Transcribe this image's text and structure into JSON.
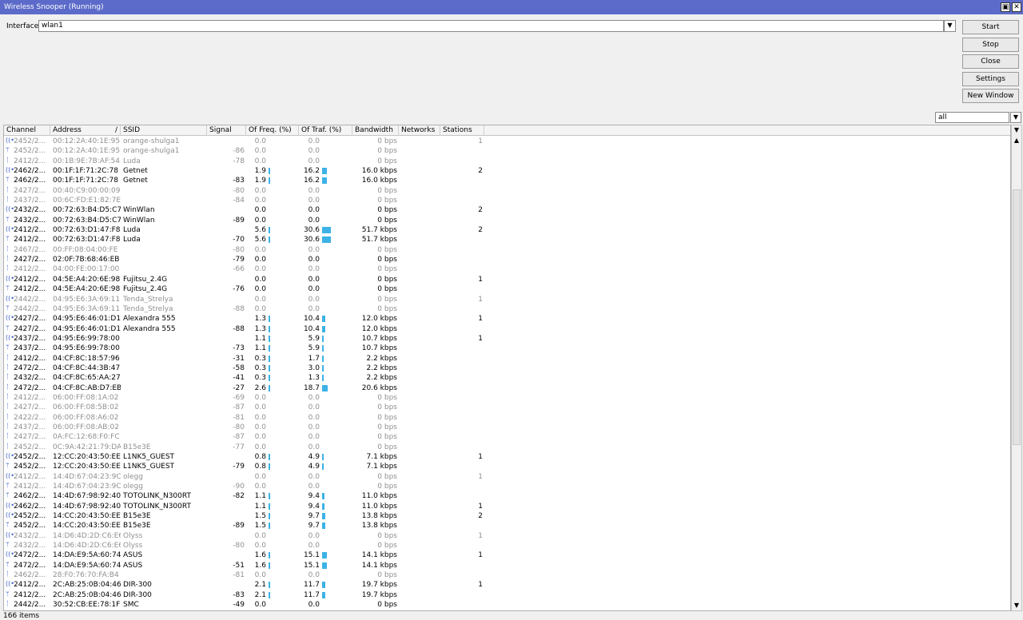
{
  "window": {
    "title": "Wireless Snooper (Running)",
    "restore_glyph": "▣",
    "close_glyph": "✕"
  },
  "interface": {
    "label": "Interface:",
    "value": "wlan1"
  },
  "buttons": {
    "start": "Start",
    "stop": "Stop",
    "close": "Close",
    "settings": "Settings",
    "new_window": "New Window"
  },
  "filter": {
    "value": "all"
  },
  "columns": [
    "Channel",
    "Address",
    "SSID",
    "Signal",
    "Of Freq. (%)",
    "Of Traf. (%)",
    "Bandwidth",
    "Networks",
    "Stations"
  ],
  "sort_indicator": "/",
  "rows": [
    {
      "t": "n",
      "ch": "2452/2...",
      "addr": "00:12:2A:40:1E:95",
      "ssid": "orange-shulga1",
      "sig": "",
      "freq": "0.0",
      "traf": "0.0",
      "bw": "0 bps",
      "net": "",
      "sta": "1",
      "dim": true,
      "fv": 0,
      "tv": 0
    },
    {
      "t": "s",
      "ch": "2452/2...",
      "addr": "00:12:2A:40:1E:95",
      "ssid": "orange-shulga1",
      "sig": "-86",
      "freq": "0.0",
      "traf": "0.0",
      "bw": "0 bps",
      "net": "",
      "sta": "",
      "dim": true,
      "fv": 0,
      "tv": 0
    },
    {
      "t": "c",
      "ch": "2412/2...",
      "addr": "00:1B:9E:7B:AF:54",
      "ssid": "Luda",
      "sig": "-78",
      "freq": "0.0",
      "traf": "0.0",
      "bw": "0 bps",
      "net": "",
      "sta": "",
      "dim": true,
      "fv": 0,
      "tv": 0
    },
    {
      "t": "n",
      "ch": "2462/2...",
      "addr": "00:1F:1F:71:2C:78",
      "ssid": "Getnet",
      "sig": "",
      "freq": "1.9",
      "traf": "16.2",
      "bw": "16.0 kbps",
      "net": "",
      "sta": "2",
      "dim": false,
      "fv": 1.9,
      "tv": 16.2
    },
    {
      "t": "s",
      "ch": "2462/2...",
      "addr": "00:1F:1F:71:2C:78",
      "ssid": "Getnet",
      "sig": "-83",
      "freq": "1.9",
      "traf": "16.2",
      "bw": "16.0 kbps",
      "net": "",
      "sta": "",
      "dim": false,
      "fv": 1.9,
      "tv": 16.2
    },
    {
      "t": "c",
      "ch": "2427/2...",
      "addr": "00:40:C9:00:00:09",
      "ssid": "",
      "sig": "-80",
      "freq": "0.0",
      "traf": "0.0",
      "bw": "0 bps",
      "net": "",
      "sta": "",
      "dim": true,
      "fv": 0,
      "tv": 0
    },
    {
      "t": "c",
      "ch": "2437/2...",
      "addr": "00:6C:FD:E1:82:7E",
      "ssid": "",
      "sig": "-84",
      "freq": "0.0",
      "traf": "0.0",
      "bw": "0 bps",
      "net": "",
      "sta": "",
      "dim": true,
      "fv": 0,
      "tv": 0
    },
    {
      "t": "n",
      "ch": "2432/2...",
      "addr": "00:72:63:B4:D5:C7",
      "ssid": "WinWlan",
      "sig": "",
      "freq": "0.0",
      "traf": "0.0",
      "bw": "0 bps",
      "net": "",
      "sta": "2",
      "dim": false,
      "fv": 0,
      "tv": 0
    },
    {
      "t": "s",
      "ch": "2432/2...",
      "addr": "00:72:63:B4:D5:C7",
      "ssid": "WinWlan",
      "sig": "-89",
      "freq": "0.0",
      "traf": "0.0",
      "bw": "0 bps",
      "net": "",
      "sta": "",
      "dim": false,
      "fv": 0,
      "tv": 0
    },
    {
      "t": "n",
      "ch": "2412/2...",
      "addr": "00:72:63:D1:47:F8",
      "ssid": "Luda",
      "sig": "",
      "freq": "5.6",
      "traf": "30.6",
      "bw": "51.7 kbps",
      "net": "",
      "sta": "2",
      "dim": false,
      "fv": 5.6,
      "tv": 30.6
    },
    {
      "t": "s",
      "ch": "2412/2...",
      "addr": "00:72:63:D1:47:F8",
      "ssid": "Luda",
      "sig": "-70",
      "freq": "5.6",
      "traf": "30.6",
      "bw": "51.7 kbps",
      "net": "",
      "sta": "",
      "dim": false,
      "fv": 5.6,
      "tv": 30.6
    },
    {
      "t": "c",
      "ch": "2467/2...",
      "addr": "00:FF:08:04:00:FE",
      "ssid": "",
      "sig": "-80",
      "freq": "0.0",
      "traf": "0.0",
      "bw": "0 bps",
      "net": "",
      "sta": "",
      "dim": true,
      "fv": 0,
      "tv": 0
    },
    {
      "t": "c",
      "ch": "2427/2...",
      "addr": "02:0F:7B:68:46:EB",
      "ssid": "",
      "sig": "-79",
      "freq": "0.0",
      "traf": "0.0",
      "bw": "0 bps",
      "net": "",
      "sta": "",
      "dim": false,
      "fv": 0,
      "tv": 0
    },
    {
      "t": "c",
      "ch": "2412/2...",
      "addr": "04:00:FE:00:17:00",
      "ssid": "",
      "sig": "-66",
      "freq": "0.0",
      "traf": "0.0",
      "bw": "0 bps",
      "net": "",
      "sta": "",
      "dim": true,
      "fv": 0,
      "tv": 0
    },
    {
      "t": "n",
      "ch": "2412/2...",
      "addr": "04:5E:A4:20:6E:98",
      "ssid": "Fujitsu_2.4G",
      "sig": "",
      "freq": "0.0",
      "traf": "0.0",
      "bw": "0 bps",
      "net": "",
      "sta": "1",
      "dim": false,
      "fv": 0,
      "tv": 0
    },
    {
      "t": "s",
      "ch": "2412/2...",
      "addr": "04:5E:A4:20:6E:98",
      "ssid": "Fujitsu_2.4G",
      "sig": "-76",
      "freq": "0.0",
      "traf": "0.0",
      "bw": "0 bps",
      "net": "",
      "sta": "",
      "dim": false,
      "fv": 0,
      "tv": 0
    },
    {
      "t": "n",
      "ch": "2442/2...",
      "addr": "04:95:E6:3A:69:11",
      "ssid": "Tenda_Strelya",
      "sig": "",
      "freq": "0.0",
      "traf": "0.0",
      "bw": "0 bps",
      "net": "",
      "sta": "1",
      "dim": true,
      "fv": 0,
      "tv": 0
    },
    {
      "t": "s",
      "ch": "2442/2...",
      "addr": "04:95:E6:3A:69:11",
      "ssid": "Tenda_Strelya",
      "sig": "-88",
      "freq": "0.0",
      "traf": "0.0",
      "bw": "0 bps",
      "net": "",
      "sta": "",
      "dim": true,
      "fv": 0,
      "tv": 0
    },
    {
      "t": "n",
      "ch": "2427/2...",
      "addr": "04:95:E6:46:01:D1",
      "ssid": "Alexandra 555",
      "sig": "",
      "freq": "1.3",
      "traf": "10.4",
      "bw": "12.0 kbps",
      "net": "",
      "sta": "1",
      "dim": false,
      "fv": 1.3,
      "tv": 10.4
    },
    {
      "t": "s",
      "ch": "2427/2...",
      "addr": "04:95:E6:46:01:D1",
      "ssid": "Alexandra 555",
      "sig": "-88",
      "freq": "1.3",
      "traf": "10.4",
      "bw": "12.0 kbps",
      "net": "",
      "sta": "",
      "dim": false,
      "fv": 1.3,
      "tv": 10.4
    },
    {
      "t": "n",
      "ch": "2437/2...",
      "addr": "04:95:E6:99:78:00",
      "ssid": "",
      "sig": "",
      "freq": "1.1",
      "traf": "5.9",
      "bw": "10.7 kbps",
      "net": "",
      "sta": "1",
      "dim": false,
      "fv": 1.1,
      "tv": 5.9
    },
    {
      "t": "s",
      "ch": "2437/2...",
      "addr": "04:95:E6:99:78:00",
      "ssid": "",
      "sig": "-73",
      "freq": "1.1",
      "traf": "5.9",
      "bw": "10.7 kbps",
      "net": "",
      "sta": "",
      "dim": false,
      "fv": 1.1,
      "tv": 5.9
    },
    {
      "t": "c",
      "ch": "2412/2...",
      "addr": "04:CF:8C:18:57:96",
      "ssid": "",
      "sig": "-31",
      "freq": "0.3",
      "traf": "1.7",
      "bw": "2.2 kbps",
      "net": "",
      "sta": "",
      "dim": false,
      "fv": 0.3,
      "tv": 1.7
    },
    {
      "t": "c",
      "ch": "2472/2...",
      "addr": "04:CF:8C:44:3B:47",
      "ssid": "",
      "sig": "-58",
      "freq": "0.3",
      "traf": "3.0",
      "bw": "2.2 kbps",
      "net": "",
      "sta": "",
      "dim": false,
      "fv": 0.3,
      "tv": 3.0
    },
    {
      "t": "c",
      "ch": "2432/2...",
      "addr": "04:CF:8C:65:AA:27",
      "ssid": "",
      "sig": "-41",
      "freq": "0.3",
      "traf": "1.3",
      "bw": "2.2 kbps",
      "net": "",
      "sta": "",
      "dim": false,
      "fv": 0.3,
      "tv": 1.3
    },
    {
      "t": "c",
      "ch": "2472/2...",
      "addr": "04:CF:8C:AB:D7:EB",
      "ssid": "",
      "sig": "-27",
      "freq": "2.6",
      "traf": "18.7",
      "bw": "20.6 kbps",
      "net": "",
      "sta": "",
      "dim": false,
      "fv": 2.6,
      "tv": 18.7
    },
    {
      "t": "c",
      "ch": "2412/2...",
      "addr": "06:00:FF:08:1A:02",
      "ssid": "",
      "sig": "-69",
      "freq": "0.0",
      "traf": "0.0",
      "bw": "0 bps",
      "net": "",
      "sta": "",
      "dim": true,
      "fv": 0,
      "tv": 0
    },
    {
      "t": "c",
      "ch": "2427/2...",
      "addr": "06:00:FF:08:5B:02",
      "ssid": "",
      "sig": "-87",
      "freq": "0.0",
      "traf": "0.0",
      "bw": "0 bps",
      "net": "",
      "sta": "",
      "dim": true,
      "fv": 0,
      "tv": 0
    },
    {
      "t": "c",
      "ch": "2422/2...",
      "addr": "06:00:FF:08:A6:02",
      "ssid": "",
      "sig": "-81",
      "freq": "0.0",
      "traf": "0.0",
      "bw": "0 bps",
      "net": "",
      "sta": "",
      "dim": true,
      "fv": 0,
      "tv": 0
    },
    {
      "t": "c",
      "ch": "2437/2...",
      "addr": "06:00:FF:08:AB:02",
      "ssid": "",
      "sig": "-80",
      "freq": "0.0",
      "traf": "0.0",
      "bw": "0 bps",
      "net": "",
      "sta": "",
      "dim": true,
      "fv": 0,
      "tv": 0
    },
    {
      "t": "c",
      "ch": "2427/2...",
      "addr": "0A:FC:12:68:F0:FC",
      "ssid": "",
      "sig": "-87",
      "freq": "0.0",
      "traf": "0.0",
      "bw": "0 bps",
      "net": "",
      "sta": "",
      "dim": true,
      "fv": 0,
      "tv": 0
    },
    {
      "t": "c",
      "ch": "2452/2...",
      "addr": "0C:9A:42:21:79:DA",
      "ssid": "B15e3E",
      "sig": "-77",
      "freq": "0.0",
      "traf": "0.0",
      "bw": "0 bps",
      "net": "",
      "sta": "",
      "dim": true,
      "fv": 0,
      "tv": 0
    },
    {
      "t": "n",
      "ch": "2452/2...",
      "addr": "12:CC:20:43:50:EE",
      "ssid": "L1NK5_GUEST",
      "sig": "",
      "freq": "0.8",
      "traf": "4.9",
      "bw": "7.1 kbps",
      "net": "",
      "sta": "1",
      "dim": false,
      "fv": 0.8,
      "tv": 4.9
    },
    {
      "t": "s",
      "ch": "2452/2...",
      "addr": "12:CC:20:43:50:EE",
      "ssid": "L1NK5_GUEST",
      "sig": "-79",
      "freq": "0.8",
      "traf": "4.9",
      "bw": "7.1 kbps",
      "net": "",
      "sta": "",
      "dim": false,
      "fv": 0.8,
      "tv": 4.9
    },
    {
      "t": "n",
      "ch": "2412/2...",
      "addr": "14:4D:67:04:23:9C",
      "ssid": "olegg",
      "sig": "",
      "freq": "0.0",
      "traf": "0.0",
      "bw": "0 bps",
      "net": "",
      "sta": "1",
      "dim": true,
      "fv": 0,
      "tv": 0
    },
    {
      "t": "s",
      "ch": "2412/2...",
      "addr": "14:4D:67:04:23:9C",
      "ssid": "olegg",
      "sig": "-90",
      "freq": "0.0",
      "traf": "0.0",
      "bw": "0 bps",
      "net": "",
      "sta": "",
      "dim": true,
      "fv": 0,
      "tv": 0
    },
    {
      "t": "s",
      "ch": "2462/2...",
      "addr": "14:4D:67:98:92:40",
      "ssid": "TOTOLINK_N300RT",
      "sig": "-82",
      "freq": "1.1",
      "traf": "9.4",
      "bw": "11.0 kbps",
      "net": "",
      "sta": "",
      "dim": false,
      "fv": 1.1,
      "tv": 9.4
    },
    {
      "t": "n",
      "ch": "2462/2...",
      "addr": "14:4D:67:98:92:40",
      "ssid": "TOTOLINK_N300RT",
      "sig": "",
      "freq": "1.1",
      "traf": "9.4",
      "bw": "11.0 kbps",
      "net": "",
      "sta": "1",
      "dim": false,
      "fv": 1.1,
      "tv": 9.4
    },
    {
      "t": "n",
      "ch": "2452/2...",
      "addr": "14:CC:20:43:50:EE",
      "ssid": "B15e3E",
      "sig": "",
      "freq": "1.5",
      "traf": "9.7",
      "bw": "13.8 kbps",
      "net": "",
      "sta": "2",
      "dim": false,
      "fv": 1.5,
      "tv": 9.7
    },
    {
      "t": "s",
      "ch": "2452/2...",
      "addr": "14:CC:20:43:50:EE",
      "ssid": "B15e3E",
      "sig": "-89",
      "freq": "1.5",
      "traf": "9.7",
      "bw": "13.8 kbps",
      "net": "",
      "sta": "",
      "dim": false,
      "fv": 1.5,
      "tv": 9.7
    },
    {
      "t": "n",
      "ch": "2432/2...",
      "addr": "14:D6:4D:2D:C6:E6",
      "ssid": "Olyss",
      "sig": "",
      "freq": "0.0",
      "traf": "0.0",
      "bw": "0 bps",
      "net": "",
      "sta": "1",
      "dim": true,
      "fv": 0,
      "tv": 0
    },
    {
      "t": "s",
      "ch": "2432/2...",
      "addr": "14:D6:4D:2D:C6:E6",
      "ssid": "Olyss",
      "sig": "-80",
      "freq": "0.0",
      "traf": "0.0",
      "bw": "0 bps",
      "net": "",
      "sta": "",
      "dim": true,
      "fv": 0,
      "tv": 0
    },
    {
      "t": "n",
      "ch": "2472/2...",
      "addr": "14:DA:E9:5A:60:74",
      "ssid": "ASUS",
      "sig": "",
      "freq": "1.6",
      "traf": "15.1",
      "bw": "14.1 kbps",
      "net": "",
      "sta": "1",
      "dim": false,
      "fv": 1.6,
      "tv": 15.1
    },
    {
      "t": "s",
      "ch": "2472/2...",
      "addr": "14:DA:E9:5A:60:74",
      "ssid": "ASUS",
      "sig": "-51",
      "freq": "1.6",
      "traf": "15.1",
      "bw": "14.1 kbps",
      "net": "",
      "sta": "",
      "dim": false,
      "fv": 1.6,
      "tv": 15.1
    },
    {
      "t": "c",
      "ch": "2462/2...",
      "addr": "28:F0:76:70:FA:B4",
      "ssid": "",
      "sig": "-81",
      "freq": "0.0",
      "traf": "0.0",
      "bw": "0 bps",
      "net": "",
      "sta": "",
      "dim": true,
      "fv": 0,
      "tv": 0
    },
    {
      "t": "n",
      "ch": "2412/2...",
      "addr": "2C:AB:25:0B:04:46",
      "ssid": "DIR-300",
      "sig": "",
      "freq": "2.1",
      "traf": "11.7",
      "bw": "19.7 kbps",
      "net": "",
      "sta": "1",
      "dim": false,
      "fv": 2.1,
      "tv": 11.7
    },
    {
      "t": "s",
      "ch": "2412/2...",
      "addr": "2C:AB:25:0B:04:46",
      "ssid": "DIR-300",
      "sig": "-83",
      "freq": "2.1",
      "traf": "11.7",
      "bw": "19.7 kbps",
      "net": "",
      "sta": "",
      "dim": false,
      "fv": 2.1,
      "tv": 11.7
    },
    {
      "t": "c",
      "ch": "2442/2...",
      "addr": "30:52:CB:EE:78:1F",
      "ssid": "SMC",
      "sig": "-49",
      "freq": "0.0",
      "traf": "0.0",
      "bw": "0 bps",
      "net": "",
      "sta": "",
      "dim": false,
      "fv": 0,
      "tv": 0
    }
  ],
  "icons": {
    "n": "network-icon",
    "s": "station-icon",
    "c": "client-icon"
  },
  "icon_glyphs": {
    "n": "((•))",
    "s": "ᛘ",
    "c": "ᛙ"
  },
  "scroll": {
    "up_glyph": "▲",
    "down_glyph": "▼",
    "top_glyph": "▼"
  },
  "status": {
    "items": "166 items"
  },
  "colors": {
    "titlebar": "#5c6bc9",
    "bar": "#3cb2e6"
  }
}
